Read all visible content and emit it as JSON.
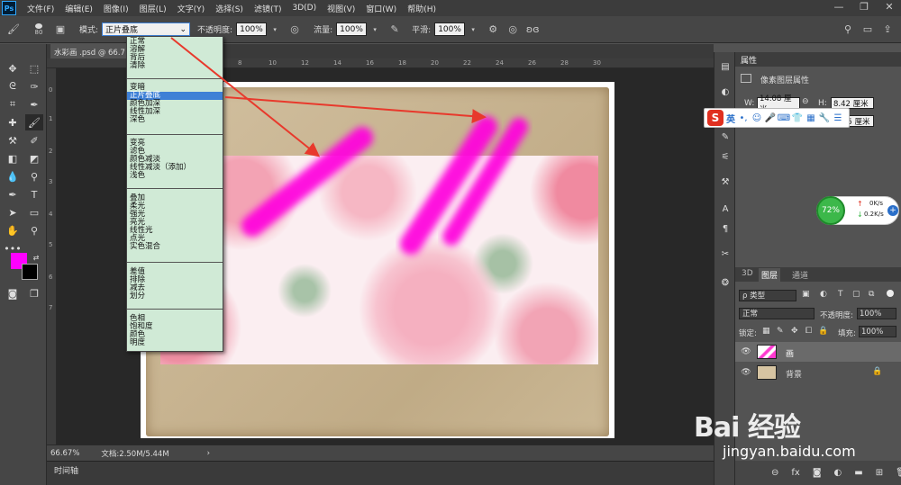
{
  "app": {
    "logo": "Ps"
  },
  "menu": [
    "文件(F)",
    "编辑(E)",
    "图像(I)",
    "图层(L)",
    "文字(Y)",
    "选择(S)",
    "滤镜(T)",
    "3D(D)",
    "视图(V)",
    "窗口(W)",
    "帮助(H)"
  ],
  "window_controls": [
    "—",
    "❐",
    "✕"
  ],
  "options": {
    "brush_size": "80",
    "mode_label": "模式:",
    "mode_value": "正片叠底",
    "opacity_label": "不透明度:",
    "opacity_value": "100%",
    "flow_label": "流量:",
    "flow_value": "100%",
    "smooth_label": "平滑:",
    "smooth_value": "100%"
  },
  "document": {
    "tab": "水彩画 .psd @ 66.7",
    "zoom": "66.67%",
    "doc_info": "文档:2.50M/5.44M",
    "ruler_top": [
      "",
      "4",
      "6",
      "8",
      "10",
      "12",
      "14",
      "16",
      "18",
      "20",
      "22",
      "24",
      "26",
      "28",
      "30"
    ],
    "ruler_left": [
      "0",
      "1",
      "2",
      "3",
      "4",
      "5",
      "6",
      "7"
    ]
  },
  "blend_modes": [
    [
      "正常",
      "溶解",
      "背后",
      "清除"
    ],
    [
      "变暗",
      "正片叠底",
      "颜色加深",
      "线性加深",
      "深色"
    ],
    [
      "变亮",
      "滤色",
      "颜色减淡",
      "线性减淡（添加）",
      "浅色"
    ],
    [
      "叠加",
      "柔光",
      "强光",
      "亮光",
      "线性光",
      "点光",
      "实色混合"
    ],
    [
      "差值",
      "排除",
      "减去",
      "划分"
    ],
    [
      "色相",
      "饱和度",
      "颜色",
      "明度"
    ]
  ],
  "blend_selected": "正片叠底",
  "properties": {
    "title": "属性",
    "subtitle": "像素图层属性",
    "w_label": "W:",
    "w_value": "14.08 厘米",
    "h_label": "H:",
    "h_value": "8.42 厘米",
    "y_value": "65 厘米"
  },
  "ime": {
    "logo": "S",
    "lang": "英"
  },
  "net": {
    "percent": "72%",
    "up": "0K/s",
    "down": "0.2K/s"
  },
  "layers": {
    "tabs": [
      "3D",
      "图层",
      "通道"
    ],
    "filter_label": "ρ 类型",
    "blend": "正常",
    "opacity_label": "不透明度:",
    "opacity_value": "100%",
    "lock_label": "锁定:",
    "fill_label": "填充:",
    "fill_value": "100%",
    "items": [
      {
        "name": "画"
      },
      {
        "name": "背景"
      }
    ]
  },
  "timeline": "时间轴",
  "watermark": {
    "logo": "Bai 经验",
    "url": "jingyan.baidu.com"
  },
  "colors": {
    "foreground": "#ff00ff",
    "background": "#000000",
    "stroke": "#ff00dd",
    "arrow": "#e8392c"
  }
}
